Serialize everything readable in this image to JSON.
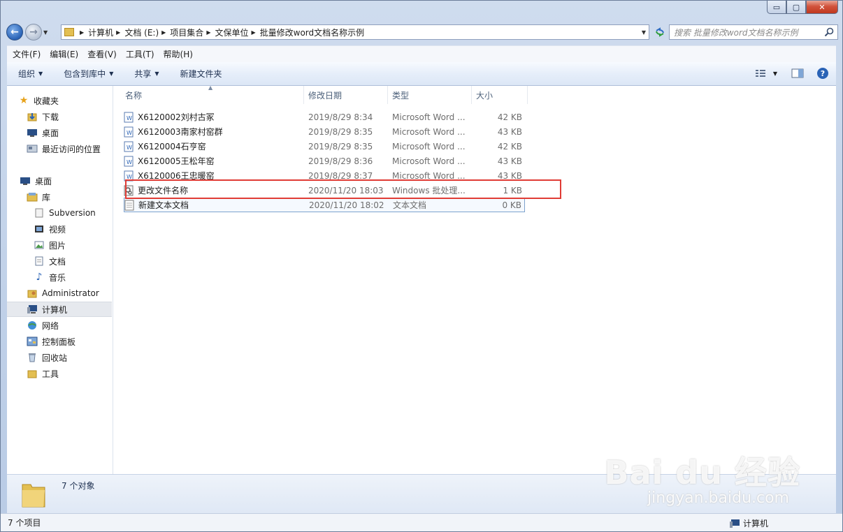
{
  "window": {
    "caption_buttons": {
      "minimize": "▭",
      "maximize": "▢",
      "close": "✕"
    }
  },
  "address": {
    "crumbs": [
      "计算机",
      "文档 (E:)",
      "项目集合",
      "文保单位",
      "批量修改word文档名称示例"
    ]
  },
  "search": {
    "placeholder": "搜索 批量修改word文档名称示例"
  },
  "menu": [
    "文件(F)",
    "编辑(E)",
    "查看(V)",
    "工具(T)",
    "帮助(H)"
  ],
  "commands": {
    "organize": "组织",
    "include_library": "包含到库中",
    "share": "共享",
    "new_folder": "新建文件夹"
  },
  "nav": {
    "favorites": "收藏夹",
    "downloads": "下载",
    "desktop_fav": "桌面",
    "recent": "最近访问的位置",
    "desktop": "桌面",
    "libraries": "库",
    "subversion": "Subversion",
    "videos": "视频",
    "pictures": "图片",
    "documents": "文档",
    "music": "音乐",
    "administrator": "Administrator",
    "computer": "计算机",
    "network": "网络",
    "control_panel": "控制面板",
    "recycle_bin": "回收站",
    "tools": "工具"
  },
  "columns": {
    "name": "名称",
    "date": "修改日期",
    "type": "类型",
    "size": "大小"
  },
  "files": [
    {
      "name": "X6120002刘村古冢",
      "date": "2019/8/29 8:34",
      "type": "Microsoft Word ...",
      "size": "42 KB",
      "icon": "word-doc-icon"
    },
    {
      "name": "X6120003南家村窑群",
      "date": "2019/8/29 8:35",
      "type": "Microsoft Word ...",
      "size": "43 KB",
      "icon": "word-doc-icon"
    },
    {
      "name": "X6120004石亨窑",
      "date": "2019/8/29 8:35",
      "type": "Microsoft Word ...",
      "size": "42 KB",
      "icon": "word-doc-icon"
    },
    {
      "name": "X6120005王松年窑",
      "date": "2019/8/29 8:36",
      "type": "Microsoft Word ...",
      "size": "43 KB",
      "icon": "word-doc-icon"
    },
    {
      "name": "X6120006王忠暖窑",
      "date": "2019/8/29 8:37",
      "type": "Microsoft Word ...",
      "size": "43 KB",
      "icon": "word-doc-icon"
    },
    {
      "name": "更改文件名称",
      "date": "2020/11/20 18:03",
      "type": "Windows 批处理...",
      "size": "1 KB",
      "icon": "batch-file-icon"
    },
    {
      "name": "新建文本文档",
      "date": "2020/11/20 18:02",
      "type": "文本文档",
      "size": "0 KB",
      "icon": "text-file-icon"
    }
  ],
  "details": {
    "count": "7 个对象"
  },
  "status": {
    "items": "7 个项目",
    "location": "计算机"
  },
  "watermark": {
    "brand": "Bai du 经验",
    "url": "jingyan.baidu.com"
  },
  "colors": {
    "highlight": "#e03c35",
    "accent": "#2a63b6"
  }
}
